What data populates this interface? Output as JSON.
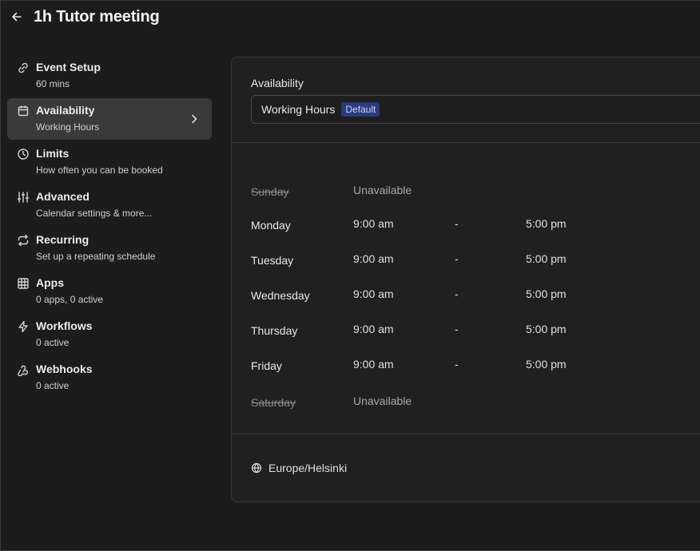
{
  "header": {
    "title": "1h Tutor meeting"
  },
  "sidebar": {
    "items": [
      {
        "label": "Event Setup",
        "sub": "60 mins",
        "icon": "link-icon"
      },
      {
        "label": "Availability",
        "sub": "Working Hours",
        "icon": "calendar-icon",
        "active": true
      },
      {
        "label": "Limits",
        "sub": "How often you can be booked",
        "icon": "clock-icon"
      },
      {
        "label": "Advanced",
        "sub": "Calendar settings & more...",
        "icon": "sliders-icon"
      },
      {
        "label": "Recurring",
        "sub": "Set up a repeating schedule",
        "icon": "repeat-icon"
      },
      {
        "label": "Apps",
        "sub": "0 apps, 0 active",
        "icon": "grid-icon"
      },
      {
        "label": "Workflows",
        "sub": "0 active",
        "icon": "zap-icon"
      },
      {
        "label": "Webhooks",
        "sub": "0 active",
        "icon": "webhook-icon"
      }
    ]
  },
  "availability": {
    "label": "Availability",
    "selected": "Working Hours",
    "badge": "Default"
  },
  "schedule": {
    "dash": "-",
    "days": [
      {
        "name": "Sunday",
        "available": false,
        "status": "Unavailable"
      },
      {
        "name": "Monday",
        "available": true,
        "start": "9:00 am",
        "end": "5:00 pm"
      },
      {
        "name": "Tuesday",
        "available": true,
        "start": "9:00 am",
        "end": "5:00 pm"
      },
      {
        "name": "Wednesday",
        "available": true,
        "start": "9:00 am",
        "end": "5:00 pm"
      },
      {
        "name": "Thursday",
        "available": true,
        "start": "9:00 am",
        "end": "5:00 pm"
      },
      {
        "name": "Friday",
        "available": true,
        "start": "9:00 am",
        "end": "5:00 pm"
      },
      {
        "name": "Saturday",
        "available": false,
        "status": "Unavailable"
      }
    ]
  },
  "timezone": {
    "value": "Europe/Helsinki",
    "icon": "globe-icon"
  },
  "colors": {
    "background": "#1c1c1c",
    "active_item": "#3a3a3a",
    "badge_bg": "#2a3a7a"
  }
}
